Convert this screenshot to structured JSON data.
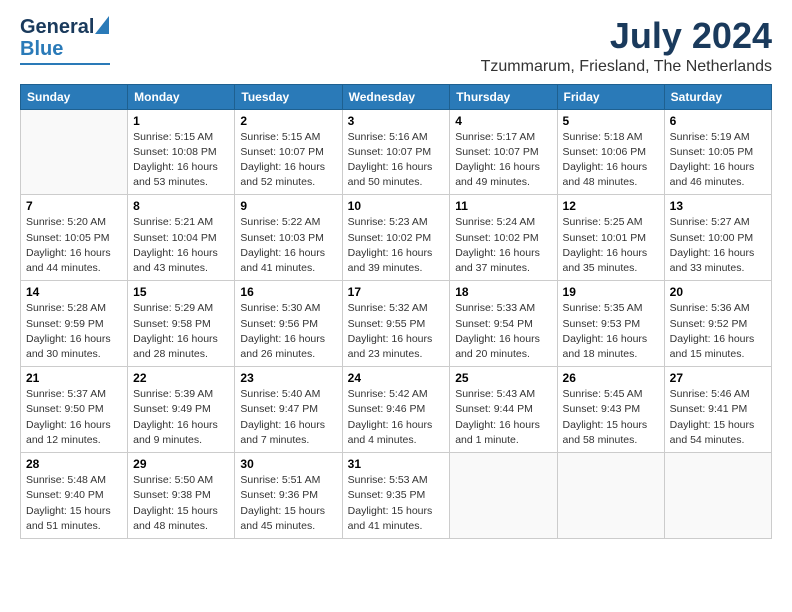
{
  "logo": {
    "general": "General",
    "blue": "Blue"
  },
  "title": "July 2024",
  "location": "Tzummarum, Friesland, The Netherlands",
  "weekdays": [
    "Sunday",
    "Monday",
    "Tuesday",
    "Wednesday",
    "Thursday",
    "Friday",
    "Saturday"
  ],
  "weeks": [
    [
      {
        "day": "",
        "text": ""
      },
      {
        "day": "1",
        "text": "Sunrise: 5:15 AM\nSunset: 10:08 PM\nDaylight: 16 hours\nand 53 minutes."
      },
      {
        "day": "2",
        "text": "Sunrise: 5:15 AM\nSunset: 10:07 PM\nDaylight: 16 hours\nand 52 minutes."
      },
      {
        "day": "3",
        "text": "Sunrise: 5:16 AM\nSunset: 10:07 PM\nDaylight: 16 hours\nand 50 minutes."
      },
      {
        "day": "4",
        "text": "Sunrise: 5:17 AM\nSunset: 10:07 PM\nDaylight: 16 hours\nand 49 minutes."
      },
      {
        "day": "5",
        "text": "Sunrise: 5:18 AM\nSunset: 10:06 PM\nDaylight: 16 hours\nand 48 minutes."
      },
      {
        "day": "6",
        "text": "Sunrise: 5:19 AM\nSunset: 10:05 PM\nDaylight: 16 hours\nand 46 minutes."
      }
    ],
    [
      {
        "day": "7",
        "text": "Sunrise: 5:20 AM\nSunset: 10:05 PM\nDaylight: 16 hours\nand 44 minutes."
      },
      {
        "day": "8",
        "text": "Sunrise: 5:21 AM\nSunset: 10:04 PM\nDaylight: 16 hours\nand 43 minutes."
      },
      {
        "day": "9",
        "text": "Sunrise: 5:22 AM\nSunset: 10:03 PM\nDaylight: 16 hours\nand 41 minutes."
      },
      {
        "day": "10",
        "text": "Sunrise: 5:23 AM\nSunset: 10:02 PM\nDaylight: 16 hours\nand 39 minutes."
      },
      {
        "day": "11",
        "text": "Sunrise: 5:24 AM\nSunset: 10:02 PM\nDaylight: 16 hours\nand 37 minutes."
      },
      {
        "day": "12",
        "text": "Sunrise: 5:25 AM\nSunset: 10:01 PM\nDaylight: 16 hours\nand 35 minutes."
      },
      {
        "day": "13",
        "text": "Sunrise: 5:27 AM\nSunset: 10:00 PM\nDaylight: 16 hours\nand 33 minutes."
      }
    ],
    [
      {
        "day": "14",
        "text": "Sunrise: 5:28 AM\nSunset: 9:59 PM\nDaylight: 16 hours\nand 30 minutes."
      },
      {
        "day": "15",
        "text": "Sunrise: 5:29 AM\nSunset: 9:58 PM\nDaylight: 16 hours\nand 28 minutes."
      },
      {
        "day": "16",
        "text": "Sunrise: 5:30 AM\nSunset: 9:56 PM\nDaylight: 16 hours\nand 26 minutes."
      },
      {
        "day": "17",
        "text": "Sunrise: 5:32 AM\nSunset: 9:55 PM\nDaylight: 16 hours\nand 23 minutes."
      },
      {
        "day": "18",
        "text": "Sunrise: 5:33 AM\nSunset: 9:54 PM\nDaylight: 16 hours\nand 20 minutes."
      },
      {
        "day": "19",
        "text": "Sunrise: 5:35 AM\nSunset: 9:53 PM\nDaylight: 16 hours\nand 18 minutes."
      },
      {
        "day": "20",
        "text": "Sunrise: 5:36 AM\nSunset: 9:52 PM\nDaylight: 16 hours\nand 15 minutes."
      }
    ],
    [
      {
        "day": "21",
        "text": "Sunrise: 5:37 AM\nSunset: 9:50 PM\nDaylight: 16 hours\nand 12 minutes."
      },
      {
        "day": "22",
        "text": "Sunrise: 5:39 AM\nSunset: 9:49 PM\nDaylight: 16 hours\nand 9 minutes."
      },
      {
        "day": "23",
        "text": "Sunrise: 5:40 AM\nSunset: 9:47 PM\nDaylight: 16 hours\nand 7 minutes."
      },
      {
        "day": "24",
        "text": "Sunrise: 5:42 AM\nSunset: 9:46 PM\nDaylight: 16 hours\nand 4 minutes."
      },
      {
        "day": "25",
        "text": "Sunrise: 5:43 AM\nSunset: 9:44 PM\nDaylight: 16 hours\nand 1 minute."
      },
      {
        "day": "26",
        "text": "Sunrise: 5:45 AM\nSunset: 9:43 PM\nDaylight: 15 hours\nand 58 minutes."
      },
      {
        "day": "27",
        "text": "Sunrise: 5:46 AM\nSunset: 9:41 PM\nDaylight: 15 hours\nand 54 minutes."
      }
    ],
    [
      {
        "day": "28",
        "text": "Sunrise: 5:48 AM\nSunset: 9:40 PM\nDaylight: 15 hours\nand 51 minutes."
      },
      {
        "day": "29",
        "text": "Sunrise: 5:50 AM\nSunset: 9:38 PM\nDaylight: 15 hours\nand 48 minutes."
      },
      {
        "day": "30",
        "text": "Sunrise: 5:51 AM\nSunset: 9:36 PM\nDaylight: 15 hours\nand 45 minutes."
      },
      {
        "day": "31",
        "text": "Sunrise: 5:53 AM\nSunset: 9:35 PM\nDaylight: 15 hours\nand 41 minutes."
      },
      {
        "day": "",
        "text": ""
      },
      {
        "day": "",
        "text": ""
      },
      {
        "day": "",
        "text": ""
      }
    ]
  ]
}
